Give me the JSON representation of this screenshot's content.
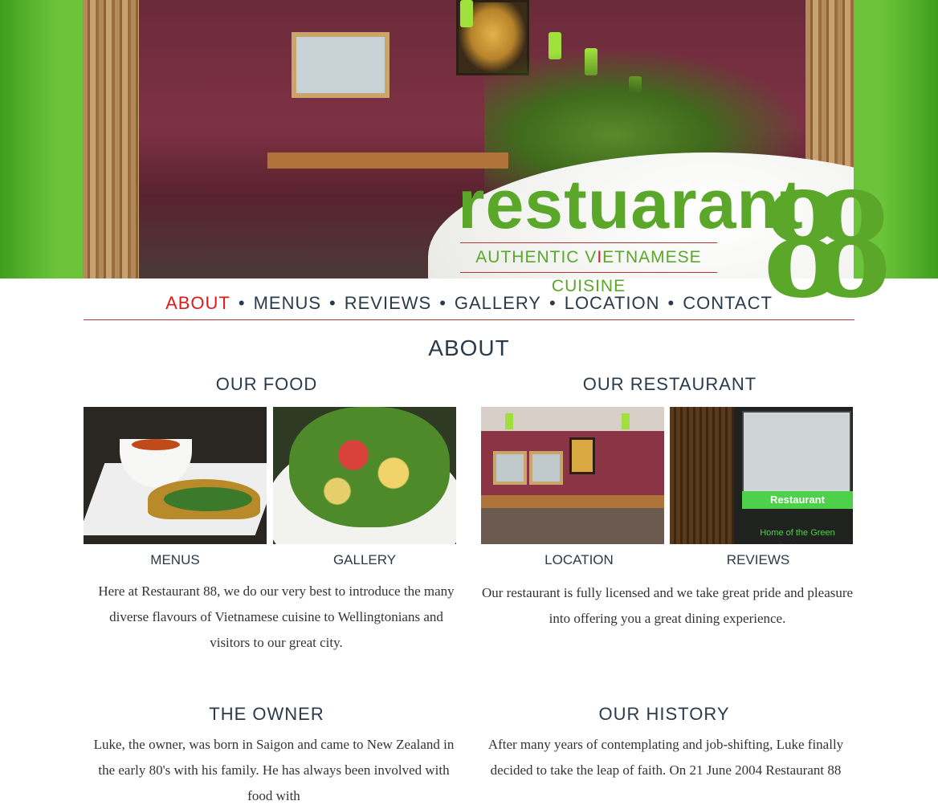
{
  "brand": {
    "word": "restuarant",
    "number": "88",
    "tagline_pre": "AUTHENTIC V",
    "tagline_highlight": "I",
    "tagline_post": "ETNAMESE CUISINE"
  },
  "nav": {
    "items": [
      "ABOUT",
      "MENUS",
      "REVIEWS",
      "GALLERY",
      "LOCATION",
      "CONTACT"
    ],
    "active": "ABOUT",
    "separator": "•"
  },
  "page": {
    "title": "ABOUT"
  },
  "food": {
    "heading": "OUR FOOD",
    "thumb1_label": "MENUS",
    "thumb2_label": "GALLERY",
    "text": "Here at Restaurant 88, we do our very best to introduce the many diverse flavours of Vietnamese cuisine to Wellingtonians and visitors to our great city."
  },
  "restaurant": {
    "heading": "OUR RESTAURANT",
    "thumb1_label": "LOCATION",
    "thumb2_label": "REVIEWS",
    "sign_text": "Restaurant",
    "sign_subtext": "Home of the Green Lanterns",
    "text": "Our restaurant is fully licensed and we take great pride and pleasure into offering you a great dining experience."
  },
  "owner": {
    "heading": "THE OWNER",
    "text": "Luke, the owner, was born in Saigon and came to New Zealand in the early 80's with his family. He has always been involved with food with"
  },
  "history": {
    "heading": "OUR HISTORY",
    "text": "After many years of contemplating and job-shifting, Luke finally decided to take the leap of faith. On 21 June 2004 Restaurant 88"
  },
  "colors": {
    "brand_green": "#5aa72a",
    "nav_active": "#e01a1a",
    "rule": "#b33333"
  }
}
